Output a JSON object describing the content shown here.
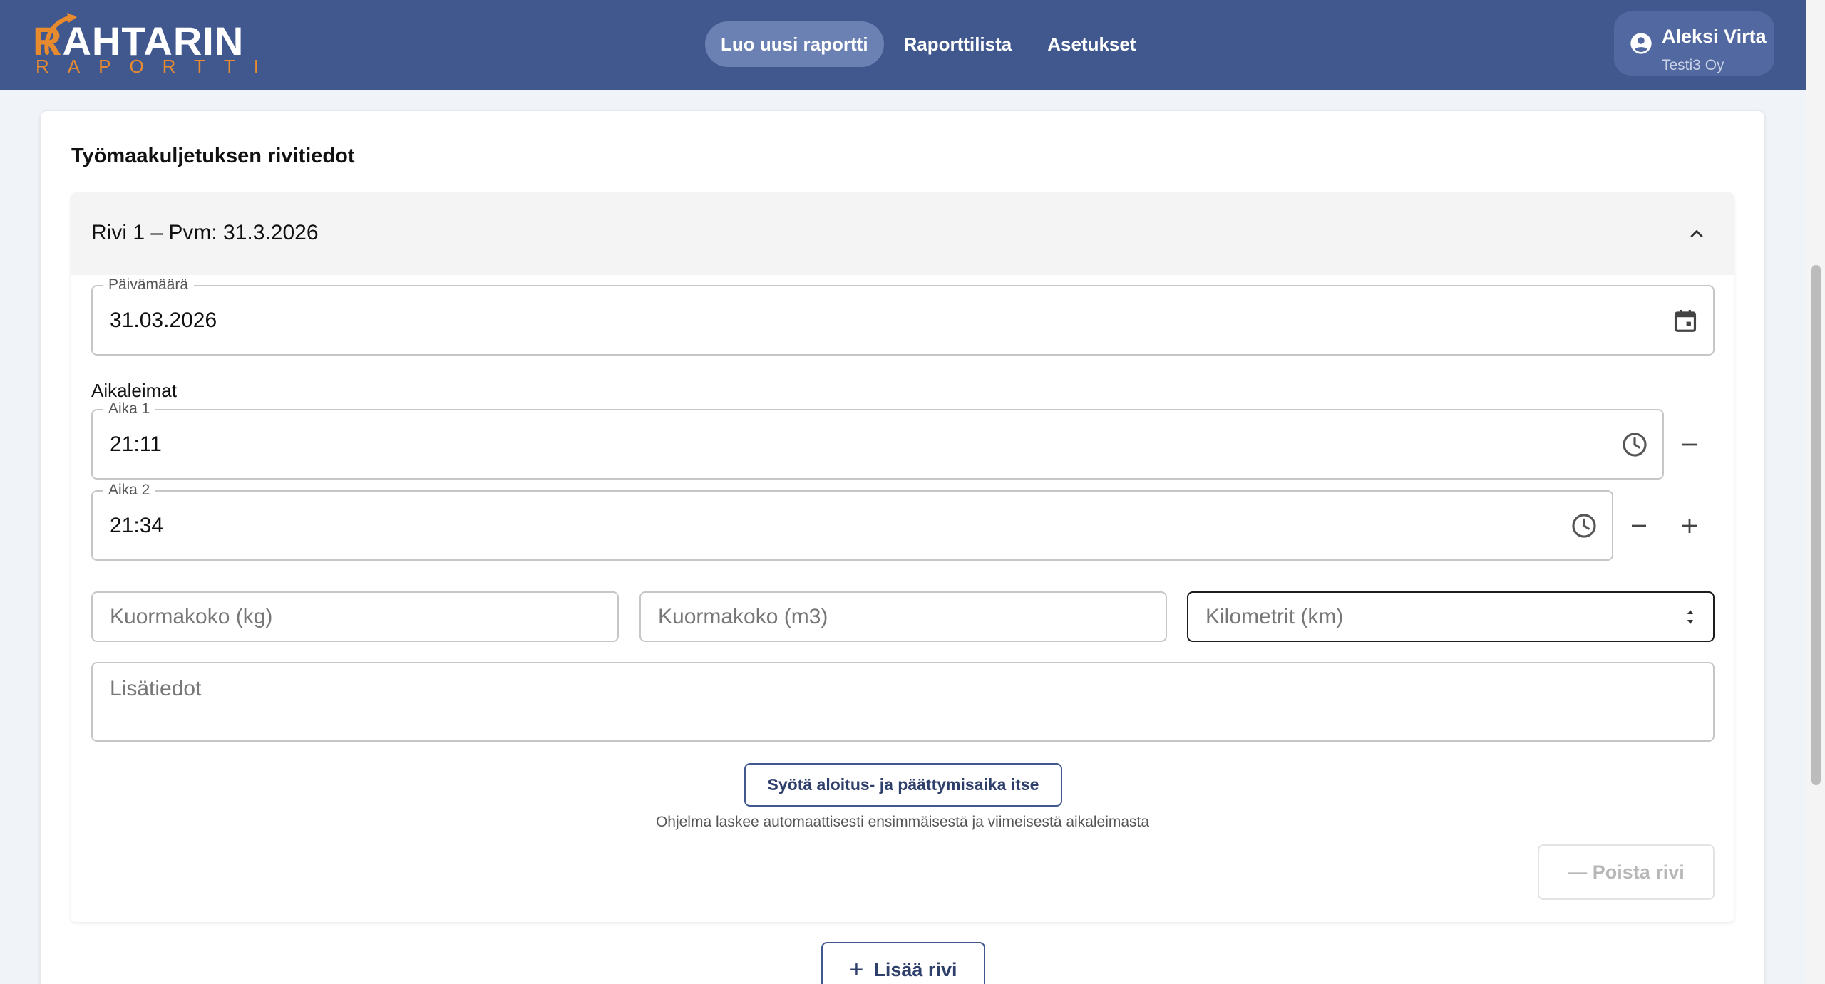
{
  "header": {
    "logo_main_first": "R",
    "logo_main_rest": "AHTARIN",
    "logo_sub": "RAPORTTI",
    "nav": [
      {
        "label": "Luo uusi raportti",
        "active": true
      },
      {
        "label": "Raporttilista",
        "active": false
      },
      {
        "label": "Asetukset",
        "active": false
      }
    ],
    "user": {
      "name": "Aleksi Virta",
      "org": "Testi3 Oy",
      "icon": "account-circle-icon"
    }
  },
  "section": {
    "title": "Työmaakuljetuksen rivitiedot"
  },
  "row": {
    "title": "Rivi 1 – Pvm: 31.3.2026",
    "date_field": {
      "label": "Päivämäärä",
      "value": "31.03.2026",
      "icon": "calendar-icon"
    },
    "timestamps_label": "Aikaleimat",
    "times": [
      {
        "label": "Aika 1",
        "value": "21:11",
        "icon": "clock-icon"
      },
      {
        "label": "Aika 2",
        "value": "21:34",
        "icon": "clock-icon"
      }
    ],
    "load_kg_placeholder": "Kuormakoko (kg)",
    "load_m3_placeholder": "Kuormakoko (m3)",
    "km_placeholder": "Kilometrit (km)",
    "notes_placeholder": "Lisätiedot",
    "manual_time_button": "Syötä aloitus- ja päättymisaika itse",
    "hint": "Ohjelma laskee automaattisesti ensimmäisestä ja viimeisestä aikaleimasta",
    "delete_button": "— Poista rivi"
  },
  "add_row_button": "Lisää rivi",
  "colors": {
    "header_bg": "#41588f",
    "accent": "#e88b2e",
    "active_nav": "#6b80b3"
  }
}
